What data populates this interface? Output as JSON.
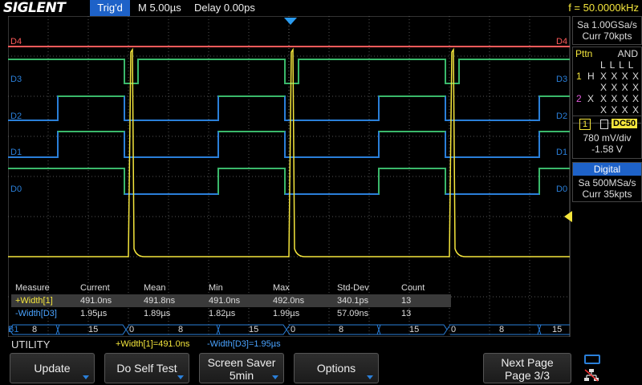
{
  "header": {
    "brand": "SIGLENT",
    "trigger_status": "Trig'd",
    "timebase": "M 5.00µs",
    "delay": "Delay 0.00ps",
    "frequency": "f = 50.0000kHz"
  },
  "acquisition": {
    "sample_rate": "Sa 1.00GSa/s",
    "memory_depth": "Curr 70kpts"
  },
  "trigger_pattern": {
    "title": "Pttn",
    "logic": "AND",
    "row_header": "L L L L",
    "row_x1": "X X X X",
    "row_x2": "X X X X",
    "row_x3": "X X X X",
    "ch1_num": "1",
    "ch1_state": "H",
    "ch2_num": "2",
    "ch2_state": "X"
  },
  "trigger_level": {
    "channel": "1",
    "coupling": "DC50",
    "scale": "780 mV/div",
    "level": "-1.58 V"
  },
  "digital": {
    "title": "Digital",
    "sample_rate": "Sa 500MSa/s",
    "memory_depth": "Curr 35kpts"
  },
  "channels": {
    "d4": "D4",
    "d3": "D3",
    "d2": "D2",
    "d1": "D1",
    "d0": "D0"
  },
  "measure_table": {
    "headers": [
      "Measure",
      "Current",
      "Mean",
      "Min",
      "Max",
      "Std-Dev",
      "Count"
    ],
    "rows": [
      [
        "+Width[1]",
        "491.0ns",
        "491.8ns",
        "491.0ns",
        "492.0ns",
        "340.1ps",
        "13"
      ],
      [
        "-Width[D3]",
        "1.95µs",
        "1.89µs",
        "1.82µs",
        "1.99µs",
        "57.09ns",
        "13"
      ]
    ]
  },
  "bus": {
    "label": "B1",
    "values": [
      "8",
      "15",
      "0",
      "8",
      "15",
      "0",
      "8",
      "15",
      "0",
      "8",
      "15"
    ]
  },
  "status": {
    "menu": "UTILITY",
    "meas1": "+Width[1]=491.0ns",
    "meas2": "-Width[D3]=1.95µs"
  },
  "softkeys": {
    "update": "Update",
    "self_test": "Do Self Test",
    "saver_line1": "Screen Saver",
    "saver_line2": "5min",
    "options": "Options",
    "next_line1": "Next Page",
    "next_line2": "Page 3/3"
  },
  "colors": {
    "ch1": "#f5e63c",
    "digital": "#2a7fd9",
    "d4": "#ff5a5a",
    "accent": "#1e62c8"
  }
}
